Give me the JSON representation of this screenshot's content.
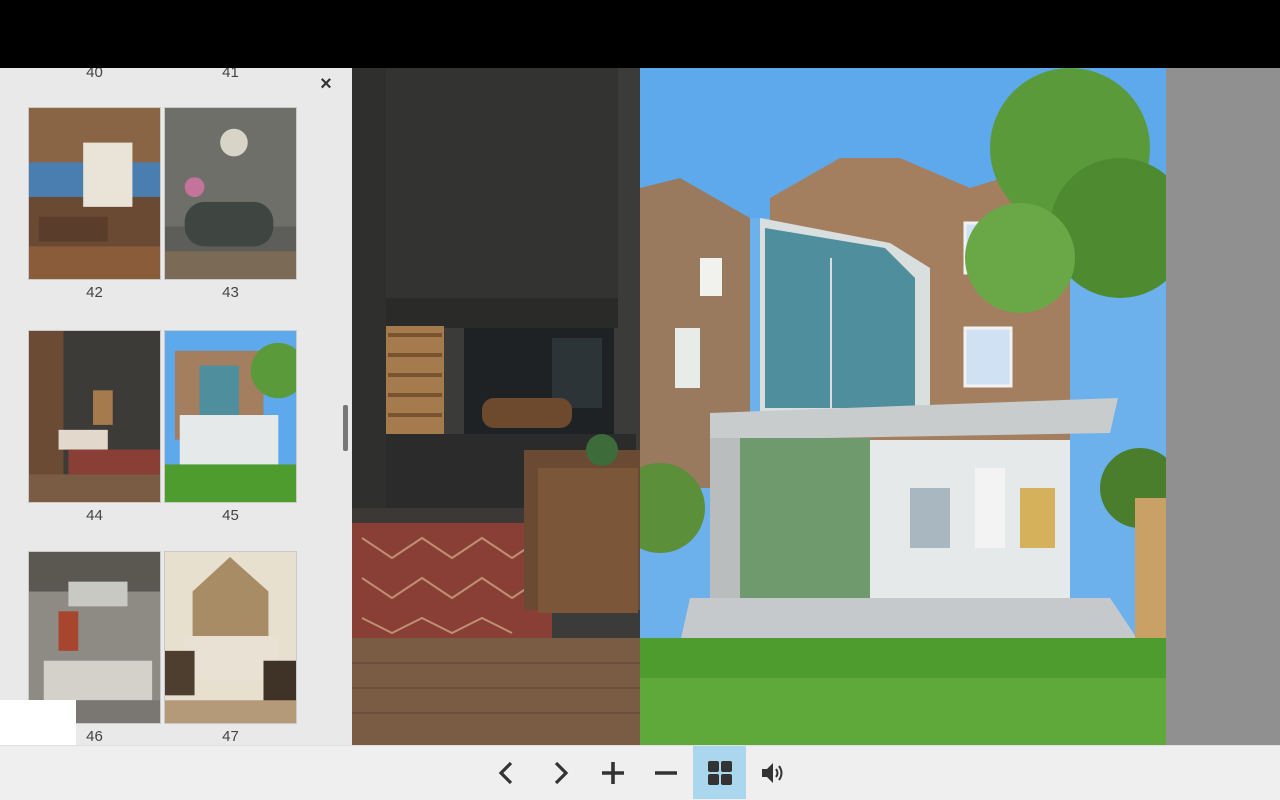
{
  "thumbnails": {
    "top_labels": [
      "40",
      "41"
    ],
    "close_label": "×",
    "spreads": [
      {
        "left_page": "42",
        "right_page": "43",
        "left_scene": "dining-room",
        "right_scene": "bathroom"
      },
      {
        "left_page": "44",
        "right_page": "45",
        "left_scene": "living-room-fireplace",
        "right_scene": "glass-extension"
      },
      {
        "left_page": "46",
        "right_page": "47",
        "left_scene": "kitchen",
        "right_scene": "bedroom"
      }
    ]
  },
  "reader": {
    "left_page_scene": "fireplace-with-logs-and-rug",
    "right_page_scene": "house-with-glass-extension-and-garden"
  },
  "toolbar": {
    "buttons": [
      {
        "name": "previous-page",
        "icon": "chevron-left-icon"
      },
      {
        "name": "next-page",
        "icon": "chevron-right-icon"
      },
      {
        "name": "zoom-in",
        "icon": "plus-icon"
      },
      {
        "name": "zoom-out",
        "icon": "minus-icon"
      },
      {
        "name": "thumbnails",
        "icon": "grid-icon",
        "active": true
      },
      {
        "name": "sound",
        "icon": "speaker-icon"
      }
    ],
    "active_color": "#aad6ee"
  }
}
